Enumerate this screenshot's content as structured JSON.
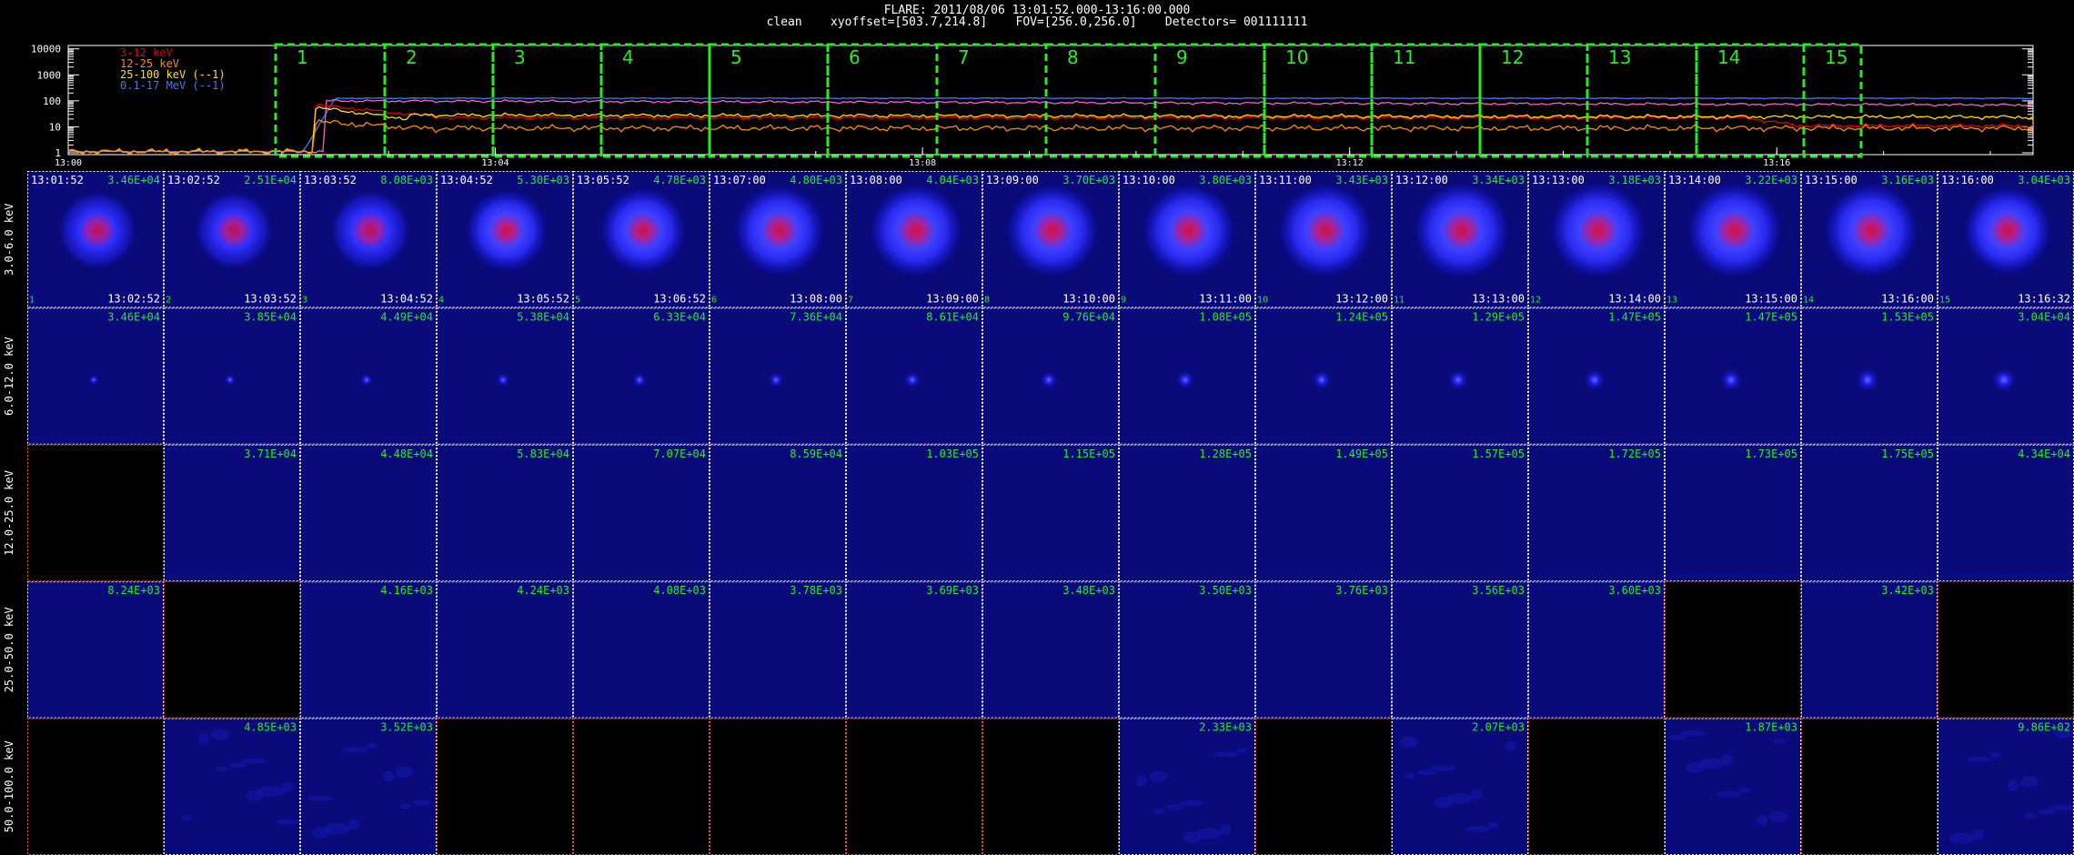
{
  "header": {
    "line1": "FLARE: 2011/08/06 13:01:52.000-13:16:00.000",
    "line2": "clean    xyoffset=[503.7,214.8]    FOV=[256.0,256.0]    Detectors= 001111111"
  },
  "lightcurve": {
    "y_ticks": [
      "10000",
      "1000",
      "100",
      "10",
      "1"
    ],
    "x_ticks": [
      "13:00",
      "13:04",
      "13:08",
      "13:12",
      "13:16"
    ],
    "legend": [
      {
        "text": "3-12 keV",
        "color": "#e00000"
      },
      {
        "text": "12-25 keV",
        "color": "#ff8c00"
      },
      {
        "text": "25-100 keV (--1)",
        "color": "#ffe000"
      },
      {
        "text": "0.1-17 MeV (--1)",
        "color": "#3a7bff"
      }
    ],
    "interval_labels": [
      "1",
      "2",
      "3",
      "4",
      "5",
      "6",
      "7",
      "8",
      "9",
      "10",
      "11",
      "12",
      "13",
      "14",
      "15"
    ],
    "interval_color": "#22ee22"
  },
  "grid": {
    "energy_labels": [
      "3.0-6.0 keV",
      "6.0-12.0 keV",
      "12.0-25.0 keV",
      "25.0-50.0 keV",
      "50.0-100.0 keV"
    ],
    "start_times": [
      "13:01:52",
      "13:02:52",
      "13:03:52",
      "13:04:52",
      "13:05:52",
      "13:07:00",
      "13:08:00",
      "13:09:00",
      "13:10:00",
      "13:11:00",
      "13:12:00",
      "13:13:00",
      "13:14:00",
      "13:15:00",
      "13:16:00"
    ],
    "end_times": [
      "13:02:52",
      "13:03:52",
      "13:04:52",
      "13:05:52",
      "13:06:52",
      "13:08:00",
      "13:09:00",
      "13:10:00",
      "13:11:00",
      "13:12:00",
      "13:13:00",
      "13:14:00",
      "13:15:00",
      "13:16:00",
      "13:16:32"
    ],
    "row_values": [
      [
        "3.46E+04",
        "2.51E+04",
        "8.08E+03",
        "5.30E+03",
        "4.78E+03",
        "4.80E+03",
        "4.04E+03",
        "3.70E+03",
        "3.80E+03",
        "3.43E+03",
        "3.34E+03",
        "3.18E+03",
        "3.22E+03",
        "3.16E+03",
        "3.04E+03"
      ],
      [
        "3.46E+04",
        "3.85E+04",
        "4.49E+04",
        "5.38E+04",
        "6.33E+04",
        "7.36E+04",
        "8.61E+04",
        "9.76E+04",
        "1.08E+05",
        "1.24E+05",
        "1.29E+05",
        "1.47E+05",
        "1.47E+05",
        "1.53E+05",
        "3.04E+04"
      ],
      [
        "",
        "3.71E+04",
        "4.48E+04",
        "5.83E+04",
        "7.07E+04",
        "8.59E+04",
        "1.03E+05",
        "1.15E+05",
        "1.28E+05",
        "1.49E+05",
        "1.57E+05",
        "1.72E+05",
        "1.73E+05",
        "1.75E+05",
        "4.34E+04"
      ],
      [
        "8.24E+03",
        "",
        "4.16E+03",
        "4.24E+03",
        "4.08E+03",
        "3.78E+03",
        "3.69E+03",
        "3.48E+03",
        "3.50E+03",
        "3.76E+03",
        "3.56E+03",
        "3.60E+03",
        "",
        "3.42E+03",
        ""
      ],
      [
        "",
        "4.85E+03",
        "3.52E+03",
        "",
        "",
        "",
        "",
        "",
        "2.33E+03",
        "",
        "2.07E+03",
        "",
        "1.87E+03",
        "",
        "9.86E+02"
      ]
    ],
    "value_color": "#22ee22"
  }
}
